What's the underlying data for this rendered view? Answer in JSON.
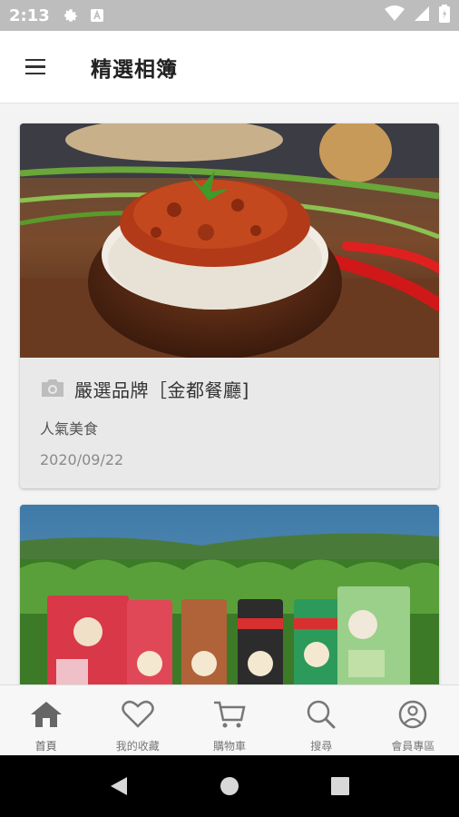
{
  "statusbar": {
    "time": "2:13"
  },
  "appbar": {
    "title": "精選相簿"
  },
  "cards": [
    {
      "title": "嚴選品牌［金都餐廳]",
      "category": "人氣美食",
      "date": "2020/09/22"
    },
    {
      "title": "",
      "category": "",
      "date": ""
    }
  ],
  "bottomnav": {
    "items": [
      {
        "label": "首頁",
        "icon": "home-icon"
      },
      {
        "label": "我的收藏",
        "icon": "heart-icon"
      },
      {
        "label": "購物車",
        "icon": "cart-icon"
      },
      {
        "label": "搜尋",
        "icon": "search-icon"
      },
      {
        "label": "會員專區",
        "icon": "user-icon"
      }
    ]
  },
  "colors": {
    "accent": "#555555",
    "statusbar": "#bdbdbd",
    "card_bg": "#e9e9e9"
  }
}
